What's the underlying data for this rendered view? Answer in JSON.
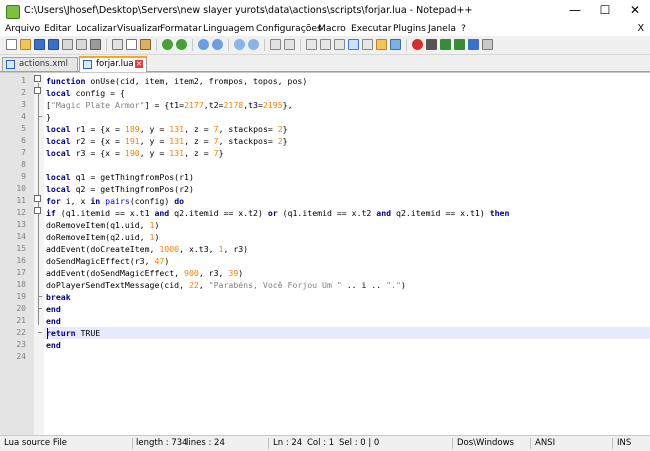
{
  "window": {
    "title": "C:\\Users\\Jhosef\\Desktop\\Servers\\new slayer yurots\\data\\actions\\scripts\\forjar.lua - Notepad++",
    "minimize": "—",
    "maximize": "☐",
    "close": "✕"
  },
  "menu": {
    "items": [
      "Arquivo",
      "Editar",
      "Localizar",
      "Visualizar",
      "Formatar",
      "Linguagem",
      "Configurações",
      "Macro",
      "Executar",
      "Plugins",
      "Janela",
      "?"
    ],
    "close_doc": "X"
  },
  "toolbar": {
    "icons": [
      "new-file-icon",
      "open-file-icon",
      "save-icon",
      "save-all-icon",
      "close-icon",
      "close-all-icon",
      "print-icon",
      "cut-icon",
      "copy-icon",
      "paste-icon",
      "undo-icon",
      "redo-icon",
      "find-icon",
      "replace-icon",
      "zoom-in-icon",
      "zoom-out-icon",
      "sync-v-icon",
      "sync-h-icon",
      "word-wrap-icon",
      "all-chars-icon",
      "indent-guide-icon",
      "doc-map-icon",
      "function-list-icon",
      "folder-workspace-icon",
      "monitor-icon",
      "record-macro-icon",
      "stop-macro-icon",
      "play-macro-icon",
      "run-macro-icon",
      "save-macro-icon",
      "spell-check-icon"
    ]
  },
  "tabs": [
    {
      "label": "actions.xml",
      "active": false
    },
    {
      "label": "forjar.lua",
      "active": true
    }
  ],
  "editor": {
    "lines": [
      "function onUse(cid, item, item2, frompos, topos, pos)",
      "local config = {",
      "[\"Magic Plate Armor\"] = {t1=2177,t2=2178,t3=2195},",
      "}",
      "local r1 = {x = 189, y = 131, z = 7, stackpos= 2}",
      "local r2 = {x = 191, y = 131, z = 7, stackpos= 2}",
      "local r3 = {x = 190, y = 131, z = 7}",
      "",
      "local q1 = getThingfromPos(r1)",
      "local q2 = getThingfromPos(r2)",
      "for i, x in pairs(config) do",
      "if (q1.itemid == x.t1 and q2.itemid == x.t2) or (q1.itemid == x.t2 and q2.itemid == x.t1) then",
      "doRemoveItem(q1.uid, 1)",
      "doRemoveItem(q2.uid, 1)",
      "addEvent(doCreateItem, 1000, x.t3, 1, r3)",
      "doSendMagicEffect(r3, 47)",
      "addEvent(doSendMagicEffect, 900, r3, 39)",
      "doPlayerSendTextMessage(cid, 22, \"Parabéns, Você Forjou Um \" .. i .. \".\")",
      "break",
      "end",
      "end",
      "return TRUE",
      "end",
      ""
    ],
    "line_numbers": [
      "1",
      "2",
      "3",
      "4",
      "5",
      "6",
      "7",
      "8",
      "9",
      "10",
      "11",
      "12",
      "13",
      "14",
      "15",
      "16",
      "17",
      "18",
      "19",
      "20",
      "21",
      "22",
      "23",
      "24"
    ],
    "current_line": 24
  },
  "status": {
    "file_type": "Lua source File",
    "length": "length : 734",
    "lines": "lines : 24",
    "ln": "Ln : 24",
    "col": "Col : 1",
    "sel": "Sel : 0 | 0",
    "eol": "Dos\\Windows",
    "encoding": "ANSI",
    "mode": "INS"
  },
  "colors": {
    "keyword": "#00008b",
    "function": "#0000ff",
    "string": "#808080",
    "number": "#ff8000",
    "current_line": "#e8e8ff",
    "active_tab_accent": "#f5a623"
  }
}
